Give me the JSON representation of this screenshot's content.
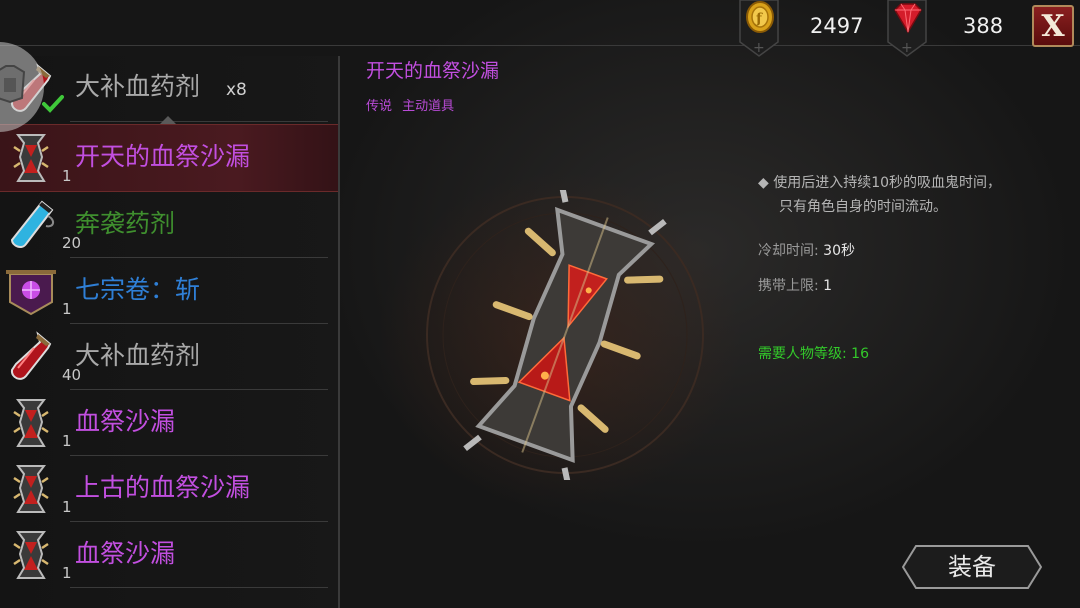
{
  "currency": {
    "gold": {
      "icon": "gold-coin-icon",
      "value": "2497"
    },
    "gems": {
      "icon": "ruby-gem-icon",
      "value": "388"
    }
  },
  "close_label": "X",
  "equipped_item": {
    "name": "大补血药剂",
    "quantity": "x8",
    "icon": "health-potion-icon"
  },
  "inventory": [
    {
      "name": "开天的血祭沙漏",
      "count": "1",
      "rarity_color": "#c24fe0",
      "icon": "blood-hourglass-icon",
      "selected": true
    },
    {
      "name": "奔袭药剂",
      "count": "20",
      "rarity_color": "#3f8f2e",
      "icon": "blue-vial-icon"
    },
    {
      "name": "七宗卷：斩",
      "count": "1",
      "rarity_color": "#2f7fd6",
      "icon": "purple-scroll-icon"
    },
    {
      "name": "大补血药剂",
      "count": "40",
      "rarity_color": "#a9a9a9",
      "icon": "health-potion-icon"
    },
    {
      "name": "血祭沙漏",
      "count": "1",
      "rarity_color": "#c24fe0",
      "icon": "blood-hourglass-icon"
    },
    {
      "name": "上古的血祭沙漏",
      "count": "1",
      "rarity_color": "#c24fe0",
      "icon": "blood-hourglass-icon"
    },
    {
      "name": "血祭沙漏",
      "count": "1",
      "rarity_color": "#c24fe0",
      "icon": "blood-hourglass-icon"
    }
  ],
  "detail": {
    "title": "开天的血祭沙漏",
    "rarity": "传说",
    "type": "主动道具",
    "description_line1": "◆ 使用后进入持续10秒的吸血鬼时间，",
    "description_line2": "只有角色自身的时间流动。",
    "cooldown_label": "冷却时间: ",
    "cooldown_value": "30秒",
    "carry_label": "携带上限: ",
    "carry_value": "1",
    "level_requirement": "需要人物等级: 16"
  },
  "equip_label": "装备"
}
